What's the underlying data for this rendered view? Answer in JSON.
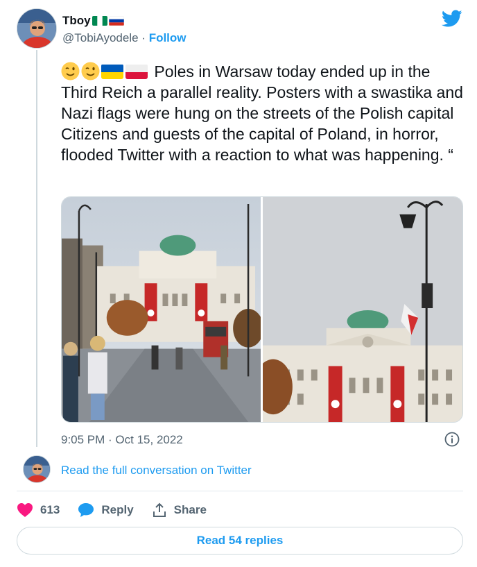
{
  "author": {
    "display_name": "Tboy",
    "handle": "@TobiAyodele",
    "separator": " · ",
    "follow_label": "Follow",
    "name_flags": [
      "nigeria-flag",
      "russia-flag"
    ]
  },
  "tweet": {
    "emoji_prefix": [
      "winking-face-emoji",
      "winking-face-emoji",
      "ukraine-flag",
      "poland-flag"
    ],
    "text": "Poles in Warsaw today ended up in the Third Reich a parallel reality. Posters with a swastika and Nazi flags were hung on the streets of the Polish capital Citizens and guests of the capital of Poland, in horror, flooded Twitter with a reaction to what was happening. “",
    "timestamp": "9:05 PM · Oct 15, 2022",
    "media": [
      {
        "name": "warsaw-street-photo"
      },
      {
        "name": "palace-facade-photo"
      }
    ]
  },
  "conversation_link": "Read the full conversation on Twitter",
  "actions": {
    "like_count": "613",
    "reply_label": "Reply",
    "share_label": "Share"
  },
  "read_replies_label": "Read 54 replies",
  "colors": {
    "twitter_blue": "#1d9bf0",
    "like_red": "#f91880",
    "secondary_text": "#536471",
    "border": "#cfd9de"
  }
}
